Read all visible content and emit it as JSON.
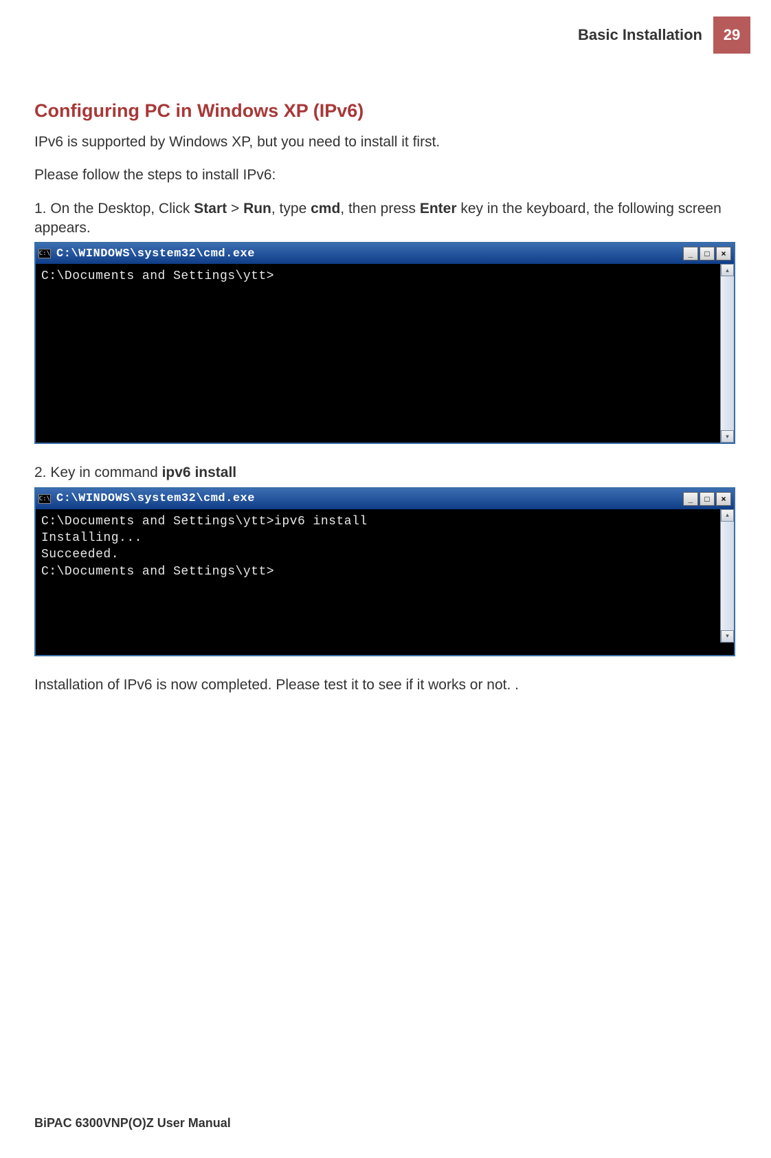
{
  "header": {
    "title": "Basic Installation",
    "page_number": "29"
  },
  "section_heading": "Configuring PC in Windows XP (IPv6)",
  "intro_1": "IPv6 is supported by Windows XP, but you need to install it first.",
  "intro_2": "Please follow the steps to install IPv6:",
  "step1": {
    "prefix": "1. On the Desktop, Click ",
    "b1": "Start",
    "sep1": " > ",
    "b2": "Run",
    "mid1": ", type ",
    "b3": "cmd",
    "mid2": ", then press ",
    "b4": "Enter",
    "suffix": " key in the keyboard, the following screen appears."
  },
  "cmd1": {
    "sysicon": "C:\\",
    "title": "C:\\WINDOWS\\system32\\cmd.exe",
    "lines": [
      "C:\\Documents and Settings\\ytt>"
    ],
    "ctrl_min": "_",
    "ctrl_max": "□",
    "ctrl_close": "×",
    "scroll_up": "▴",
    "scroll_down": "▾"
  },
  "step2": {
    "prefix": "2. Key in command ",
    "b1": "ipv6 install"
  },
  "cmd2": {
    "sysicon": "C:\\",
    "title": "C:\\WINDOWS\\system32\\cmd.exe",
    "lines": [
      "C:\\Documents and Settings\\ytt>ipv6 install",
      "Installing...",
      "Succeeded.",
      "",
      "C:\\Documents and Settings\\ytt>"
    ],
    "ctrl_min": "_",
    "ctrl_max": "□",
    "ctrl_close": "×",
    "scroll_up": "▴",
    "scroll_down": "▾"
  },
  "closing": "Installation of IPv6 is now completed.  Please test it to see if it works or not. .",
  "footer": "BiPAC 6300VNP(O)Z User Manual"
}
